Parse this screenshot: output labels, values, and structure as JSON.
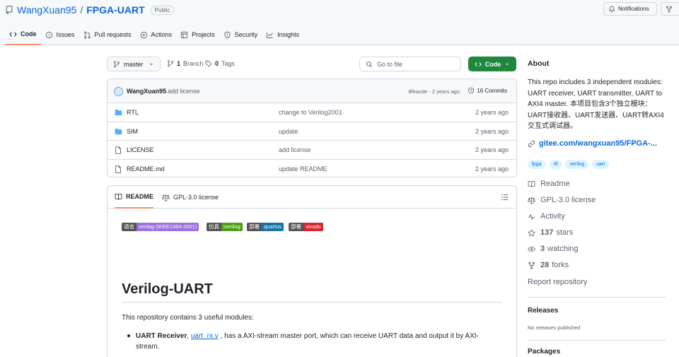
{
  "header": {
    "owner": "WangXuan95",
    "slash": "/",
    "repo": "FPGA-UART",
    "visibility": "Public",
    "notifications_label": "Notifications",
    "tabs": [
      {
        "label": "Code",
        "icon": "code-icon"
      },
      {
        "label": "Issues",
        "icon": "issue-icon"
      },
      {
        "label": "Pull requests",
        "icon": "pull-request-icon"
      },
      {
        "label": "Actions",
        "icon": "play-icon"
      },
      {
        "label": "Projects",
        "icon": "table-icon"
      },
      {
        "label": "Security",
        "icon": "shield-icon"
      },
      {
        "label": "Insights",
        "icon": "graph-icon"
      }
    ]
  },
  "filenav": {
    "branch": "master",
    "branch_count": "1",
    "branch_label": "Branch",
    "tag_count": "0",
    "tag_label": "Tags",
    "search_placeholder": "Go to file",
    "code_button": "Code"
  },
  "commit": {
    "author": "WangXuan95",
    "message": "add license",
    "hash_time": "8feacde · 2 years ago",
    "count_label": "16 Commits"
  },
  "files": [
    {
      "name": "RTL",
      "type": "folder",
      "message": "change to Verilog2001",
      "date": "2 years ago"
    },
    {
      "name": "SIM",
      "type": "folder",
      "message": "update",
      "date": "2 years ago"
    },
    {
      "name": "LICENSE",
      "type": "file",
      "message": "add license",
      "date": "2 years ago"
    },
    {
      "name": "README.md",
      "type": "file",
      "message": "update README",
      "date": "2 years ago"
    }
  ],
  "readme": {
    "tab_readme": "README",
    "tab_license": "GPL-3.0 license",
    "shields": [
      {
        "label": "语言",
        "value": "verilog (IEEE1364-2001)",
        "color": "#9a71e0"
      },
      {
        "label": "仿真",
        "value": "iverilog",
        "color": "#4c9f10"
      },
      {
        "label": "部署",
        "value": "quartus",
        "color": "#1674a8"
      },
      {
        "label": "部署",
        "value": "vivado",
        "color": "#d8262e"
      }
    ],
    "heading": "Verilog-UART",
    "intro": "This repository contains 3 useful modules:",
    "bullet_title": "UART Receiver",
    "bullet_sep": ", ",
    "bullet_link": "uart_rx.v",
    "bullet_text": " , has a AXI-stream master port, which can receive UART data and output it by AXI-stream."
  },
  "sidebar": {
    "about_heading": "About",
    "description": "This repo includes 3 independent modules: UART receiver, UART transmitter, UART to AXI4 master. 本项目包含3个独立模块：UART接收器、UART发送器、UART转AXI4交互式调试器。",
    "link": "gitee.com/wangxuan95/FPGA-...",
    "topics": [
      "fpga",
      "rtl",
      "verilog",
      "uart"
    ],
    "readme": "Readme",
    "license": "GPL-3.0 license",
    "activity": "Activity",
    "stars_count": "137",
    "stars_label": "stars",
    "watching_count": "3",
    "watching_label": "watching",
    "forks_count": "28",
    "forks_label": "forks",
    "report": "Report repository",
    "releases_heading": "Releases",
    "releases_text": "No releases published",
    "packages_heading": "Packages"
  },
  "colors": {
    "accent": "#0969da",
    "green": "#1f883d",
    "folder": "#54aeff",
    "tab_underline": "#fd8c73"
  }
}
